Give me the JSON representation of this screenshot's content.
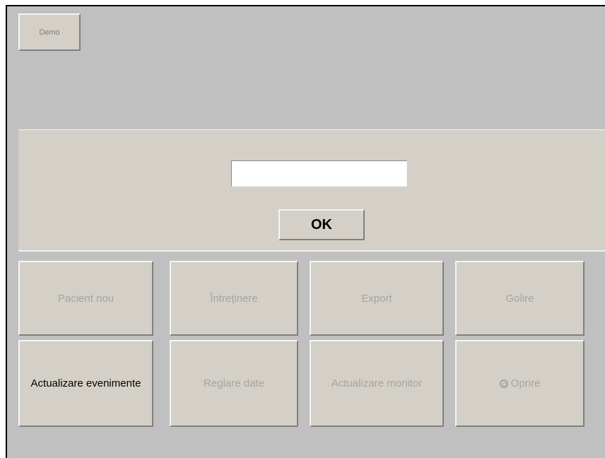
{
  "toolbar": {
    "demo_label": "Demo"
  },
  "login": {
    "pin_value": "",
    "ok_label": "OK"
  },
  "buttons": {
    "pacient_nou": "Pacient nou",
    "intretinere": "Întreținere",
    "export": "Export",
    "golire": "Golire",
    "actualizare_evenimente": "Actualizare evenimente",
    "reglare_date": "Reglare date",
    "actualizare_monitor": "Actualizare monitor",
    "oprire": "Oprire"
  },
  "icons": {
    "oprire": "power-icon"
  },
  "colors": {
    "background": "#c0c0c0",
    "button_face": "#d4d0c8",
    "disabled_text": "#a4a4a4"
  }
}
